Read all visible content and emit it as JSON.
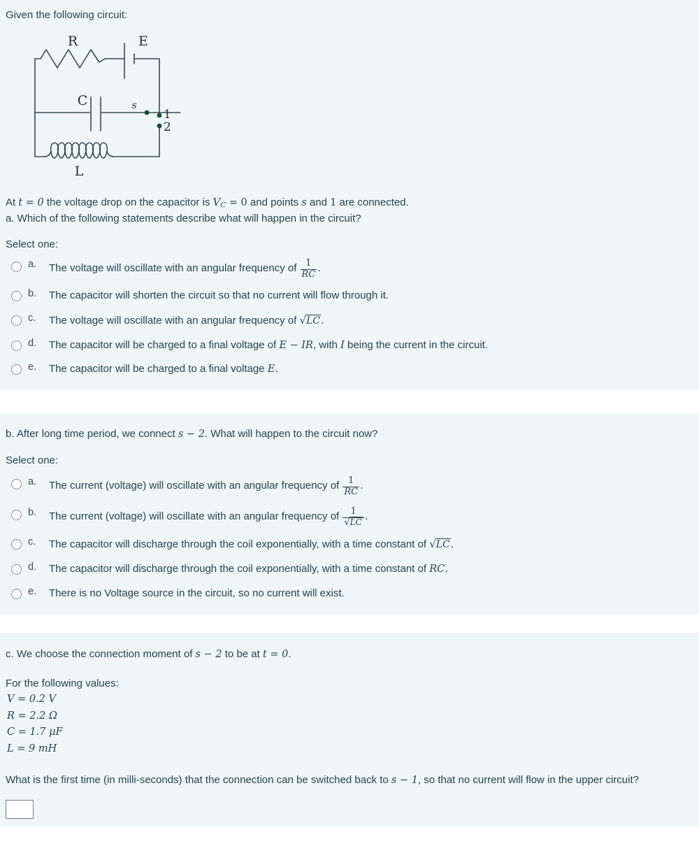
{
  "intro": {
    "text": "Given the following circuit:"
  },
  "circuit": {
    "labels": {
      "resistor": "R",
      "battery": "E",
      "capacitor": "C",
      "inductor": "L",
      "switch": "s",
      "terminal_1": "1",
      "terminal_2": "2"
    }
  },
  "part_a": {
    "statement_prefix": "At ",
    "statement_t": "t = 0",
    "statement_mid": " the voltage drop on the capacitor is ",
    "statement_vc": "V",
    "statement_vc_sub": "C",
    "statement_vc_eq": " = 0",
    "statement_mid2": " and points ",
    "statement_s": "s",
    "statement_and": " and ",
    "statement_one": "1",
    "statement_end": " are connected.",
    "question": "a. Which of the following statements describe what will happen in the circuit?",
    "select_one": "Select one:",
    "options": [
      {
        "key": "a.",
        "text_before": "The voltage will oscillate with an angular frequency of ",
        "formula": "frac_1_RC",
        "frac_num": "1",
        "frac_den": "RC",
        "text_after": "."
      },
      {
        "key": "b.",
        "text_before": "The capacitor will shorten the circuit so that no current will flow through it.",
        "formula": "none",
        "text_after": ""
      },
      {
        "key": "c.",
        "text_before": "The voltage will oscillate with an angular frequency of ",
        "formula": "sqrt_LC",
        "sqrt_radicand": "LC",
        "text_after": "."
      },
      {
        "key": "d.",
        "text_before": "The capacitor will be charged to a final voltage of ",
        "formula": "inline_math",
        "inline_math": "E − IR",
        "text_middle": ", with ",
        "inline_math2": "I",
        "text_after": " being the current in the circuit."
      },
      {
        "key": "e.",
        "text_before": "The capacitor will be charged to a final voltage ",
        "formula": "inline_math",
        "inline_math": "E",
        "text_after": "."
      }
    ]
  },
  "part_b": {
    "question_prefix": "b. After long time period, we connect ",
    "question_math": "s − 2",
    "question_suffix": ". What will happen to the circuit now?",
    "select_one": "Select one:",
    "options": [
      {
        "key": "a.",
        "text_before": "The current (voltage) will oscillate with an angular frequency of ",
        "formula": "frac_1_RC",
        "frac_num": "1",
        "frac_den": "RC",
        "text_after": "."
      },
      {
        "key": "b.",
        "text_before": "The current (voltage) will oscillate with an angular frequency of ",
        "formula": "frac_1_sqrtLC",
        "frac_num": "1",
        "frac_den_sqrt": "LC",
        "text_after": "."
      },
      {
        "key": "c.",
        "text_before": "The capacitor will discharge through the coil exponentially, with a time constant of ",
        "formula": "sqrt_LC",
        "sqrt_radicand": "LC",
        "text_after": "."
      },
      {
        "key": "d.",
        "text_before": "The capacitor will discharge through the coil exponentially, with a time constant of ",
        "formula": "inline_math",
        "inline_math": "RC",
        "text_after": "."
      },
      {
        "key": "e.",
        "text_before": "There is no Voltage source in the circuit, so no current will exist.",
        "formula": "none",
        "text_after": ""
      }
    ]
  },
  "part_c": {
    "line1_prefix": "c. We choose the connection moment of ",
    "line1_math": "s − 2",
    "line1_mid": " to be at ",
    "line1_math2": "t = 0",
    "line1_suffix": ".",
    "values_heading": "For the following values:",
    "values": [
      "V = 0.2 V",
      "R = 2.2 Ω",
      "C = 1.7 μF",
      "L = 9 mH"
    ],
    "final_question_prefix": "What is the first time (in milli-seconds) that the connection can be switched back to ",
    "final_question_math": "s − 1",
    "final_question_suffix": ", so that no current will flow in the upper circuit?",
    "answer_value": "",
    "answer_placeholder": ""
  },
  "colors": {
    "background": "#eff6f8",
    "separator": "#ffffff",
    "text": "#28424e",
    "circuit_stroke": "#3a4a52",
    "node_dot": "#1d4a2e",
    "radio_border": "#8a9399",
    "input_border": "#707a80"
  }
}
